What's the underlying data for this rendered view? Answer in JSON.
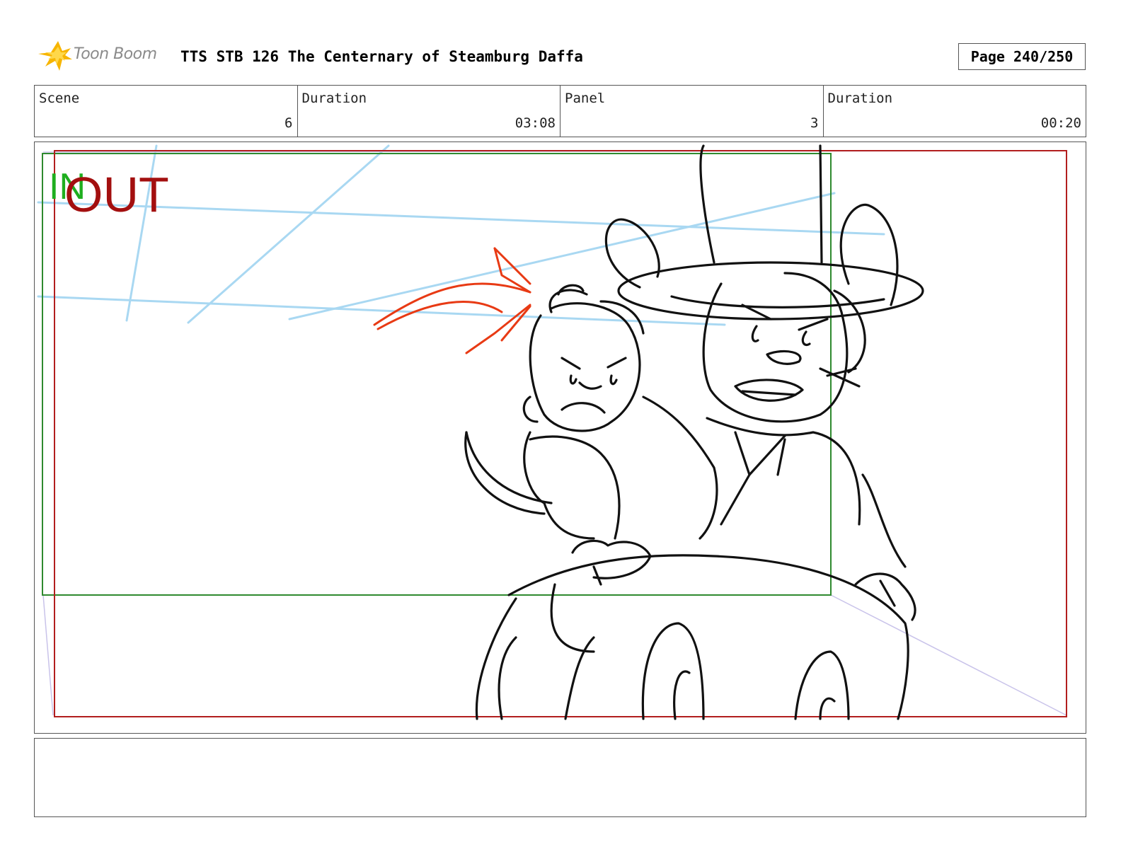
{
  "header": {
    "brand": "Toon Boom",
    "title": "TTS STB 126 The Centernary of Steamburg Daffa",
    "page": "Page 240/250"
  },
  "info": {
    "scene_label": "Scene",
    "scene_value": "6",
    "scene_duration_label": "Duration",
    "scene_duration_value": "03:08",
    "panel_label": "Panel",
    "panel_value": "3",
    "panel_duration_label": "Duration",
    "panel_duration_value": "00:20"
  },
  "panel": {
    "in_label": "IN",
    "out_label": "OUT",
    "in_color": "#1fae1f",
    "out_color": "#a30f0f",
    "guide_color": "#a9d8f2",
    "arrow_color": "#e83a14"
  },
  "notes": ""
}
